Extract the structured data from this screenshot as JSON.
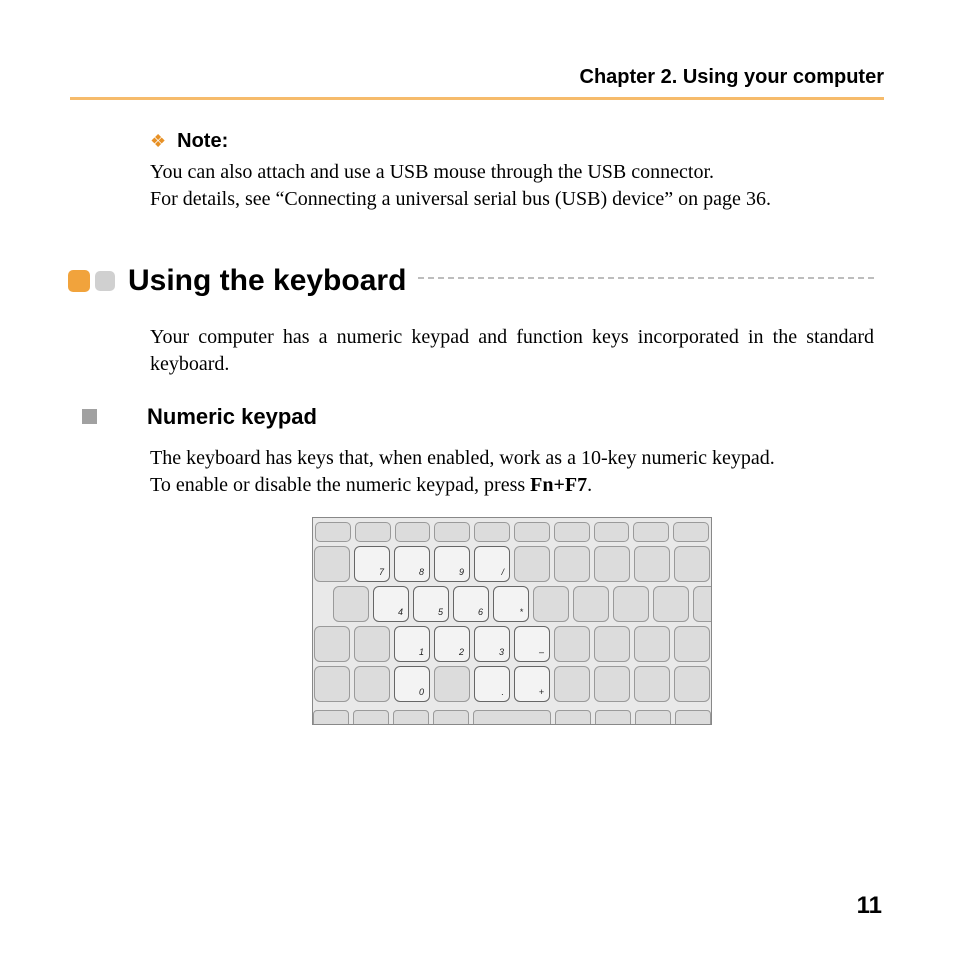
{
  "chapter_title": "Chapter 2. Using your computer",
  "note": {
    "label": "Note:",
    "p1": "You can also attach and use a USB mouse through the USB connector.",
    "p2a": "For details, see “Connecting a universal serial bus (USB) device” on page 36."
  },
  "section": {
    "title": "Using the keyboard",
    "intro": "Your computer has a numeric keypad and function keys incorporated in the standard keyboard."
  },
  "subsection": {
    "title": "Numeric keypad",
    "p1": "The keyboard has keys that, when enabled, work as a 10-key numeric keypad.",
    "p2_prefix": "To enable or disable the numeric keypad, press ",
    "p2_bold": "Fn+F7",
    "p2_suffix": "."
  },
  "keys": {
    "r1": [
      "7",
      "8",
      "9",
      "/"
    ],
    "r2": [
      "4",
      "5",
      "6",
      "*"
    ],
    "r3": [
      "1",
      "2",
      "3",
      "–"
    ],
    "r4": [
      "0",
      "",
      ".",
      "+"
    ]
  },
  "page_number": "11"
}
